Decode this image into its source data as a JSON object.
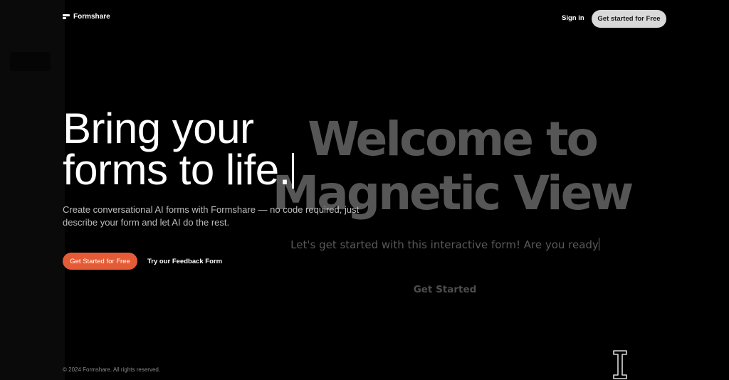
{
  "header": {
    "brand": "Formshare",
    "signin_label": "Sign in",
    "cta_label": "Get started for Free"
  },
  "hero": {
    "title_line1": "Bring your",
    "title_line2": "forms to life.",
    "description": "Create conversational AI forms with Formshare — no code required, just describe your form and let AI do the rest.",
    "primary_cta_label": "Get Started for Free",
    "secondary_link_label": "Try our Feedback Form"
  },
  "magnetic_view": {
    "title_line1": "Welcome to",
    "title_line2": "Magnetic View",
    "subtitle": "Let's get started with this interactive form! Are you ready",
    "button_label": "Get Started"
  },
  "footer": {
    "copyright": "© 2024 Formshare. All rights reserved."
  },
  "colors": {
    "background": "#000000",
    "accent": "#e55b35",
    "header_cta_bg": "#d9d9d9",
    "faded_text": "#5b5b5b"
  },
  "icons": {
    "logo": "formshare-logo-icon",
    "cursor": "text-cursor-icon"
  }
}
